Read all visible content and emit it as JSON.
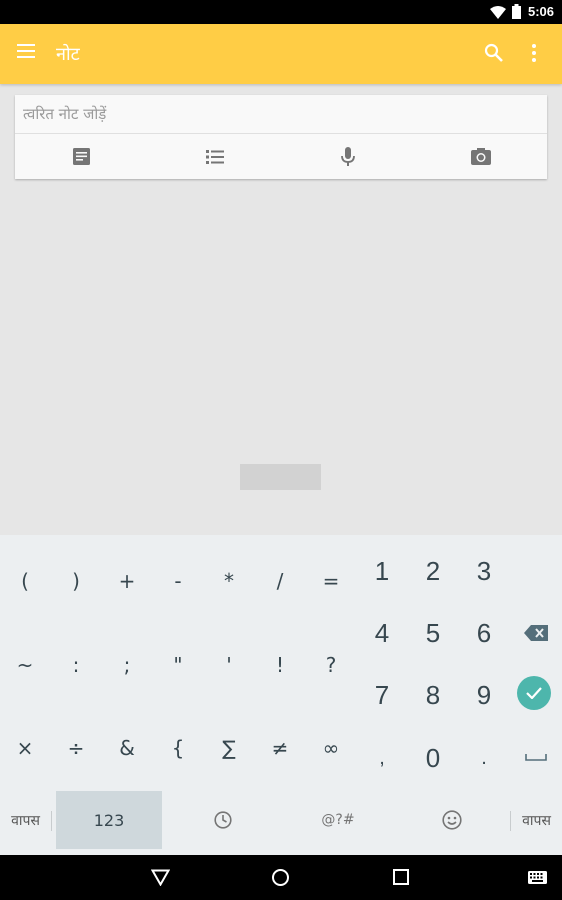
{
  "status_bar": {
    "time": "5:06"
  },
  "app_bar": {
    "title": "नोट"
  },
  "note": {
    "placeholder": "त्वरित नोट जोड़ें"
  },
  "keyboard": {
    "symbols_row1": [
      "(",
      ")",
      "+",
      "-",
      "*",
      "/",
      "="
    ],
    "symbols_row2": [
      "~",
      ":",
      ";",
      "\"",
      "'",
      "!",
      "?"
    ],
    "symbols_row3": [
      "×",
      "÷",
      "&",
      "{",
      "∑",
      "≠",
      "∞"
    ],
    "numbers_row1": [
      "1",
      "2",
      "3"
    ],
    "numbers_row2": [
      "4",
      "5",
      "6"
    ],
    "numbers_row3": [
      "7",
      "8",
      "9"
    ],
    "numbers_row4": [
      ",",
      "0",
      "."
    ],
    "back_left": "वापस",
    "mode_123": "123",
    "symbols_mode": "@?#",
    "back_right": "वापस"
  },
  "colors": {
    "app_bar": "#ffcd45",
    "accent": "#4db6ac"
  }
}
